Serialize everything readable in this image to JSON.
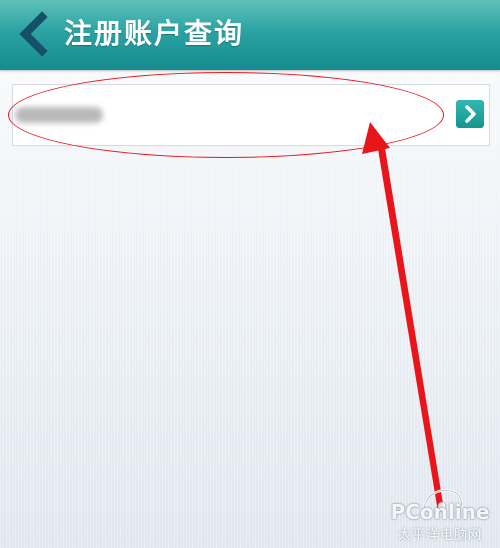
{
  "header": {
    "title": "注册账户查询",
    "back_icon": "chevron-left-icon",
    "background_color": "#1f9a9c"
  },
  "account_row": {
    "account_text": "",
    "is_obscured": true,
    "action_icon": "chevron-right-icon",
    "action_color": "#15958f"
  },
  "annotation": {
    "color": "#e8161b",
    "shapes": [
      "ellipse",
      "arrow"
    ]
  },
  "watermark": {
    "brand": "PConline",
    "subtitle": "太平洋电脑网"
  }
}
